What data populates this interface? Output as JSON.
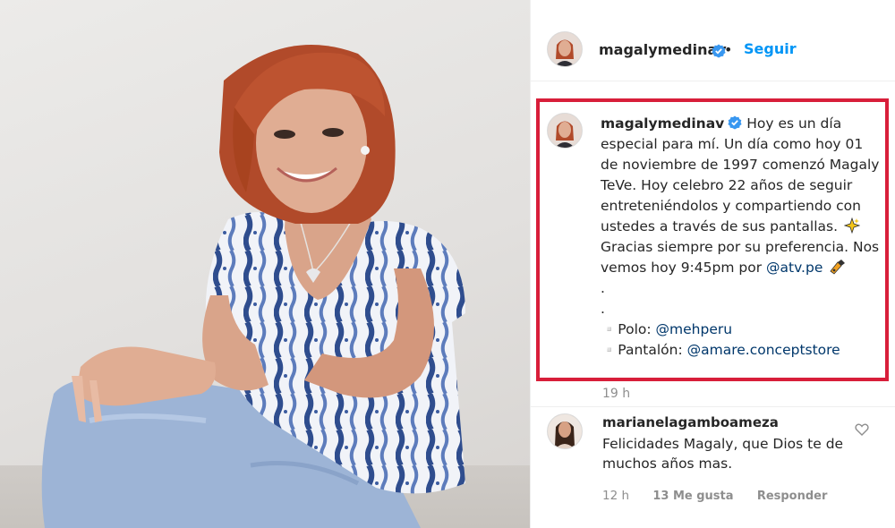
{
  "post": {
    "username": "magalymedinav",
    "follow_label": "Seguir",
    "separator": "•"
  },
  "caption": {
    "username": "magalymedinav",
    "line1": "Hoy es un día especial para mí. Un día como hoy 01 de noviembre de 1997 comenzó Magaly TeVe. Hoy celebro 22 años de seguir entreteniéndolos y compartiendo con ustedes a través de sus pantallas.",
    "line2": "Gracias siempre por su preferencia. Nos vemos hoy 9:45pm por",
    "mention_main": "@atv.pe",
    "dot1": ".",
    "dot2": ".",
    "polo_label": "▫️Polo:",
    "polo_mention": "@mehperu",
    "pantalon_label": "▫️Pantalón:",
    "pantalon_mention": "@amare.conceptstore",
    "emoji_sparkles": "sparkles-icon",
    "emoji_camera": "movie-camera-icon",
    "time": "19 h"
  },
  "comment": {
    "username": "marianelagamboameza",
    "text": "Felicidades Magaly, que Dios te de muchos años mas.",
    "time": "12 h",
    "likes": "13 Me gusta",
    "reply": "Responder"
  },
  "colors": {
    "highlight_border": "#d81e3a",
    "link_blue": "#0095f6",
    "mention": "#00376b",
    "verified_badge": "#3897f0"
  }
}
